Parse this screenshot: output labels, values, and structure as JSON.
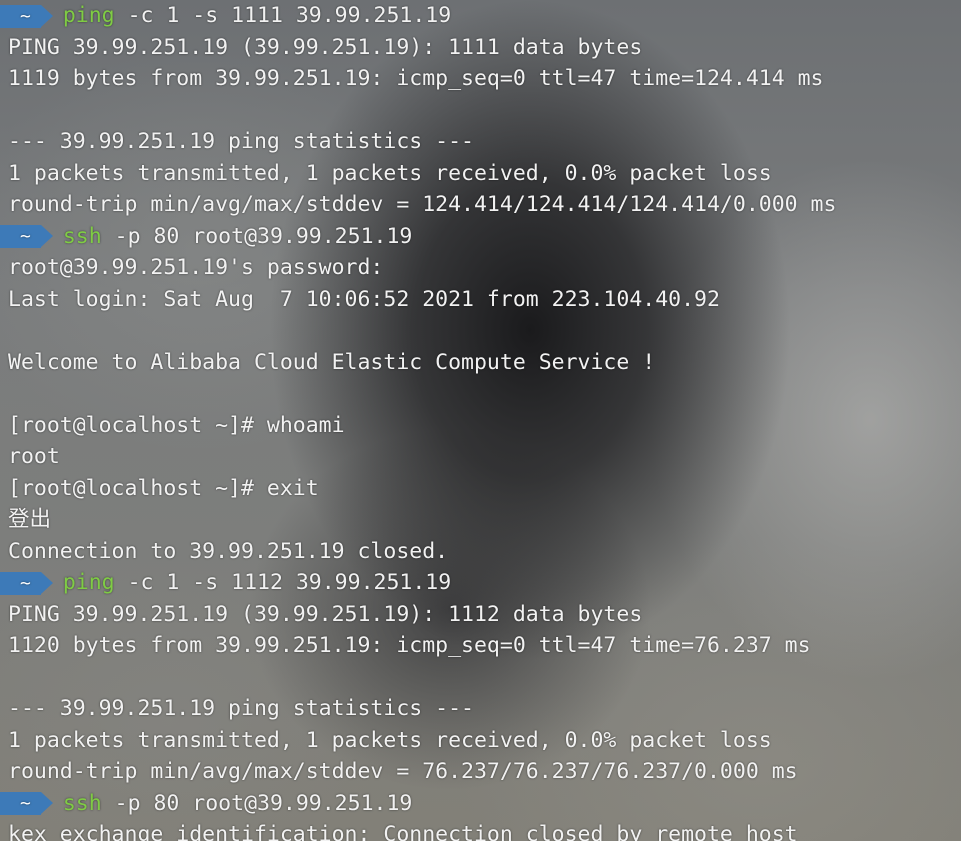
{
  "prompt": {
    "dir": "~"
  },
  "lines": [
    {
      "type": "prompt",
      "cmd": "ping",
      "args": " -c 1 -s 1111 39.99.251.19"
    },
    {
      "type": "out",
      "text": "PING 39.99.251.19 (39.99.251.19): 1111 data bytes"
    },
    {
      "type": "out",
      "text": "1119 bytes from 39.99.251.19: icmp_seq=0 ttl=47 time=124.414 ms"
    },
    {
      "type": "out",
      "text": ""
    },
    {
      "type": "out",
      "text": "--- 39.99.251.19 ping statistics ---"
    },
    {
      "type": "out",
      "text": "1 packets transmitted, 1 packets received, 0.0% packet loss"
    },
    {
      "type": "out",
      "text": "round-trip min/avg/max/stddev = 124.414/124.414/124.414/0.000 ms"
    },
    {
      "type": "prompt",
      "cmd": "ssh",
      "args": " -p 80 root@39.99.251.19"
    },
    {
      "type": "out",
      "text": "root@39.99.251.19's password:"
    },
    {
      "type": "out",
      "text": "Last login: Sat Aug  7 10:06:52 2021 from 223.104.40.92"
    },
    {
      "type": "out",
      "text": ""
    },
    {
      "type": "out",
      "text": "Welcome to Alibaba Cloud Elastic Compute Service !"
    },
    {
      "type": "out",
      "text": ""
    },
    {
      "type": "out",
      "text": "[root@localhost ~]# whoami"
    },
    {
      "type": "out",
      "text": "root"
    },
    {
      "type": "out",
      "text": "[root@localhost ~]# exit"
    },
    {
      "type": "out",
      "text": "登出"
    },
    {
      "type": "out",
      "text": "Connection to 39.99.251.19 closed."
    },
    {
      "type": "prompt",
      "cmd": "ping",
      "args": " -c 1 -s 1112 39.99.251.19"
    },
    {
      "type": "out",
      "text": "PING 39.99.251.19 (39.99.251.19): 1112 data bytes"
    },
    {
      "type": "out",
      "text": "1120 bytes from 39.99.251.19: icmp_seq=0 ttl=47 time=76.237 ms"
    },
    {
      "type": "out",
      "text": ""
    },
    {
      "type": "out",
      "text": "--- 39.99.251.19 ping statistics ---"
    },
    {
      "type": "out",
      "text": "1 packets transmitted, 1 packets received, 0.0% packet loss"
    },
    {
      "type": "out",
      "text": "round-trip min/avg/max/stddev = 76.237/76.237/76.237/0.000 ms"
    },
    {
      "type": "prompt",
      "cmd": "ssh",
      "args": " -p 80 root@39.99.251.19"
    },
    {
      "type": "out",
      "text": "kex_exchange_identification: Connection closed by remote host"
    }
  ]
}
